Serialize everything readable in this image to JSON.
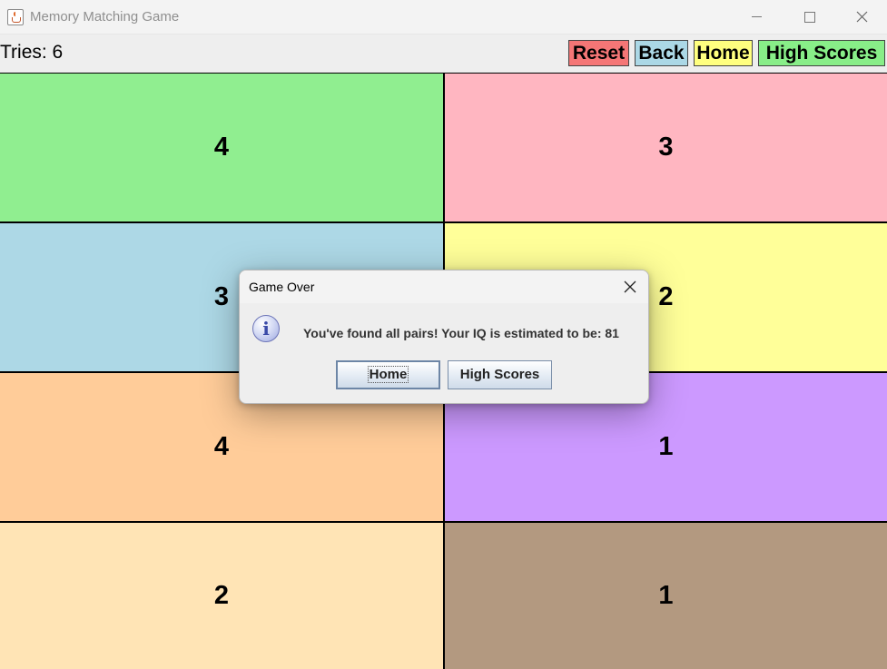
{
  "window": {
    "title": "Memory Matching Game",
    "icon": "java-cup-icon"
  },
  "toolbar": {
    "tries_label": "Tries: 6",
    "buttons": [
      {
        "label": "Reset",
        "color": "#f47676"
      },
      {
        "label": "Back",
        "color": "#abd8e6"
      },
      {
        "label": "Home",
        "color": "#ffff7f"
      },
      {
        "label": "High Scores",
        "color": "#88ee88"
      }
    ]
  },
  "cards": [
    {
      "value": "4",
      "color": "#90ee90"
    },
    {
      "value": "3",
      "color": "#ffb6c1"
    },
    {
      "value": "3",
      "color": "#add8e6"
    },
    {
      "value": "2",
      "color": "#ffff99"
    },
    {
      "value": "4",
      "color": "#ffcc99"
    },
    {
      "value": "1",
      "color": "#cc99ff"
    },
    {
      "value": "2",
      "color": "#ffe4b5"
    },
    {
      "value": "1",
      "color": "#b39980"
    }
  ],
  "dialog": {
    "title": "Game Over",
    "icon": "info-icon",
    "message": "You've found all pairs! Your IQ is estimated to be: 81",
    "buttons": [
      "Home",
      "High Scores"
    ]
  }
}
